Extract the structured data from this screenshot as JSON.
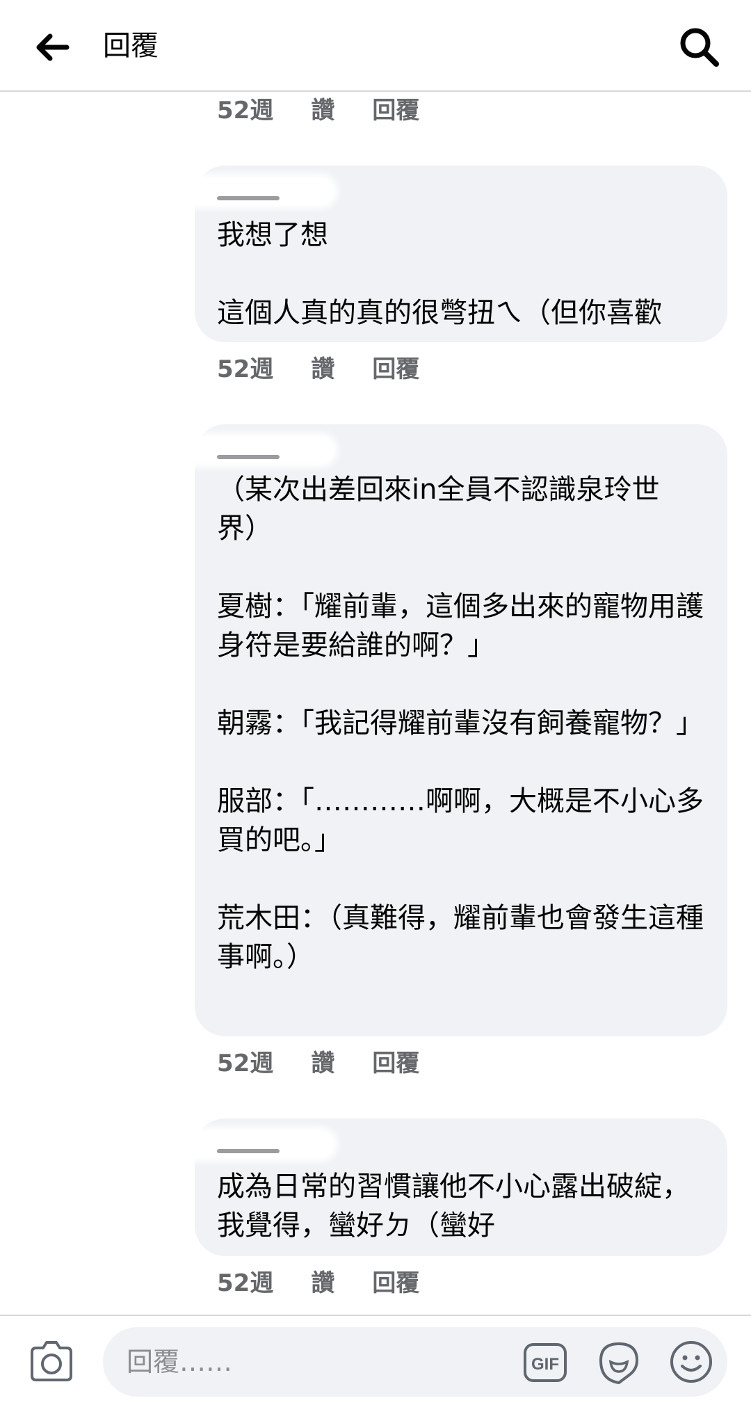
{
  "header": {
    "title": "回覆"
  },
  "comments": [
    {
      "time": "52週",
      "like": "讚",
      "reply": "回覆"
    },
    {
      "body": "我想了想\n\n這個人真的真的很彆扭ㄟ（但你喜歡",
      "time": "52週",
      "like": "讚",
      "reply": "回覆"
    },
    {
      "body": "（某次出差回來in全員不認識泉玲世界）\n\n夏樹：「耀前輩，這個多出來的寵物用護身符是要給誰的啊？」\n\n朝霧：「我記得耀前輩沒有飼養寵物？」\n\n服部：「…………啊啊，大概是不小心多買的吧。」\n\n荒木田：（真難得，耀前輩也會發生這種事啊。）",
      "time": "52週",
      "like": "讚",
      "reply": "回覆"
    },
    {
      "body": "成為日常的習慣讓他不小心露出破綻，我覺得，蠻好ㄉ（蠻好",
      "time": "52週",
      "like": "讚",
      "reply": "回覆"
    }
  ],
  "composer": {
    "placeholder": "回覆……",
    "gif_label": "GIF"
  },
  "icons": {
    "back": "arrow-left-icon",
    "search": "magnifier-icon",
    "camera": "camera-icon",
    "gif": "gif-icon",
    "sticker": "sticker-icon",
    "emoji": "smiley-icon"
  },
  "colors": {
    "bubble": "#f0f2f5",
    "meta_text": "#65676b",
    "divider": "#d5d7db"
  }
}
